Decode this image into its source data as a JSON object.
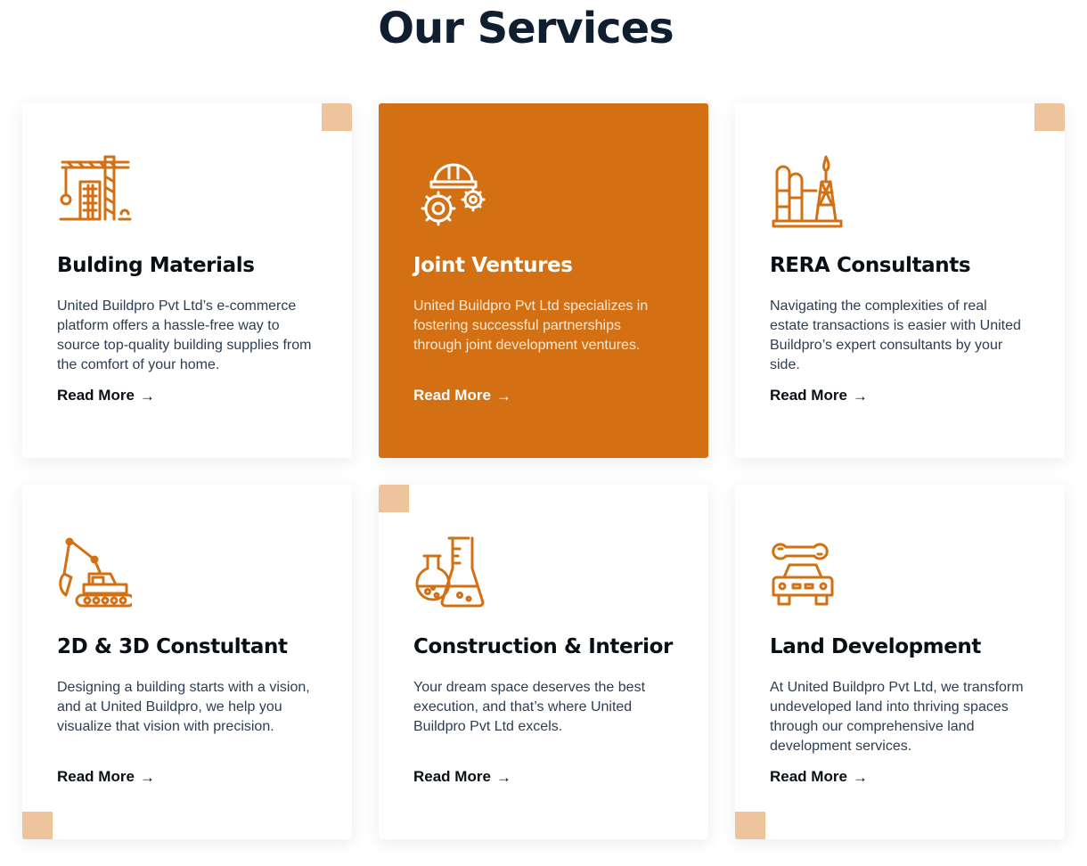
{
  "section": {
    "title": "Our Services"
  },
  "colors": {
    "accent": "#d27013",
    "corner": "#eec49c",
    "heading": "#0f1f30"
  },
  "cards": [
    {
      "icon": "tower-crane-icon",
      "title": "Bulding Materials",
      "description": "United Buildpro Pvt Ltd’s e-commerce platform offers a hassle-free way to source top-quality building supplies from the comfort of your home.",
      "link": "Read More",
      "arrow": "→"
    },
    {
      "icon": "hardhat-gears-icon",
      "title": "Joint Ventures",
      "description": "United Buildpro Pvt Ltd specializes in fostering successful partnerships through joint development ventures.",
      "link": "Read More",
      "arrow": "→"
    },
    {
      "icon": "refinery-icon",
      "title": "RERA Consultants",
      "description": "Navigating the complexities of real estate transactions is easier with United Buildpro’s expert consultants by your side.",
      "link": "Read More",
      "arrow": "→"
    },
    {
      "icon": "excavator-icon",
      "title": "2D & 3D Constultant",
      "description": "Designing a building starts with a vision, and at United Buildpro, we help you visualize that vision with precision.",
      "link": "Read More",
      "arrow": "→"
    },
    {
      "icon": "flasks-icon",
      "title": "Construction & Interior",
      "description": "Your dream space deserves the best execution, and that’s where United Buildpro Pvt Ltd excels.",
      "link": "Read More",
      "arrow": "→"
    },
    {
      "icon": "car-wrench-icon",
      "title": "Land Development",
      "description": "At United Buildpro Pvt Ltd, we transform undeveloped land into thriving spaces through our comprehensive land development services.",
      "link": "Read More",
      "arrow": "→"
    }
  ]
}
